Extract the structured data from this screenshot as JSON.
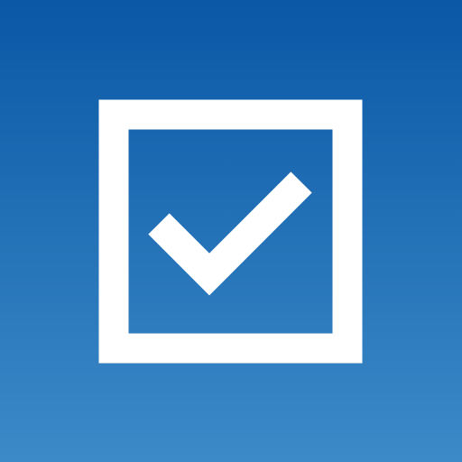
{
  "app_icon": {
    "name": "checkbox-checked-icon",
    "background_top": "#0a58a6",
    "background_bottom": "#3d8ac8",
    "foreground": "#ffffff",
    "checked": true
  }
}
